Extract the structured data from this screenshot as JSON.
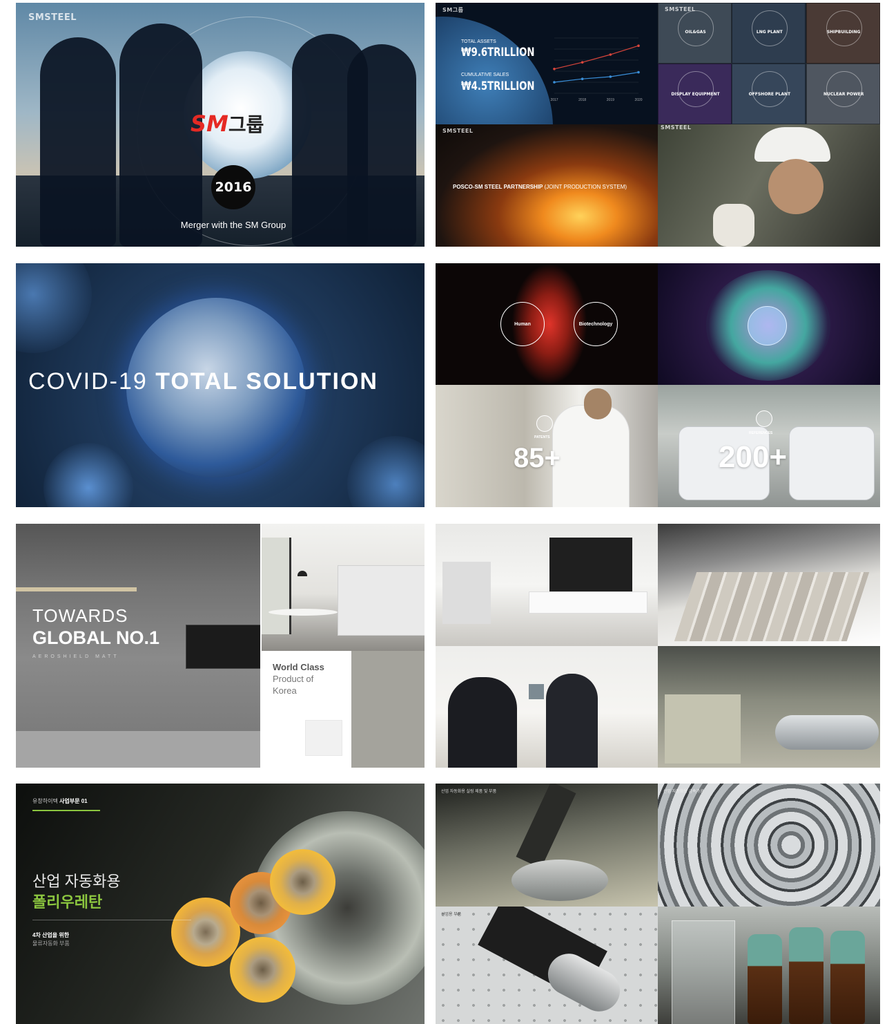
{
  "row1": {
    "sm_group": {
      "brand": "SMSTEEL",
      "logo_sm": "SM",
      "logo_kr": "그룹",
      "year": "2016",
      "caption": "Merger with the SM Group"
    },
    "assets": {
      "brand": "SM그룹",
      "total_assets_label": "TOTAL ASSETS",
      "total_assets_value": "₩9.6TRILLION",
      "cumulative_sales_label": "CUMULATIVE SALES",
      "cumulative_sales_value": "₩4.5TRILLION",
      "chart_data": {
        "type": "line",
        "categories": [
          "2017",
          "2018",
          "2019",
          "2020"
        ],
        "series": [
          {
            "values": [
              2.2,
              2.8,
              3.5,
              4.3
            ]
          },
          {
            "values": [
              1.0,
              1.3,
              1.5,
              1.9
            ]
          }
        ],
        "colors": [
          "#d9453b",
          "#3a8fd9"
        ]
      }
    },
    "industries": {
      "brand": "SMSTEEL",
      "items": [
        "OIL&GAS",
        "LNG PLANT",
        "SHIPBUILDING",
        "DISPLAY EQUIPMENT",
        "OFFSHORE PLANT",
        "NUCLEAR POWER"
      ]
    },
    "posco": {
      "brand": "SMSTEEL",
      "caption_bold": "POSCO-SM STEEL PARTNERSHIP",
      "caption_light": "(JOINT PRODUCTION SYSTEM)"
    },
    "worker": {
      "brand": "SMSTEEL"
    }
  },
  "row2": {
    "covid": {
      "title_light": "COVID-19",
      "title_bold": "TOTAL SOLUTION"
    },
    "bio": {
      "left_circle": "Human",
      "right_circle": "Biotechnology"
    },
    "patents": {
      "label": "PATENTS",
      "value": "85+"
    },
    "references": {
      "label": "REFERENCES",
      "value": "200+"
    }
  },
  "row3": {
    "kitchen": {
      "line1": "TOWARDS",
      "line2": "GLOBAL NO.1",
      "sub": "AEROSHIELD MATT"
    },
    "world_class": {
      "line1": "World Class",
      "line2": "Product of",
      "line3": "Korea"
    }
  },
  "row4": {
    "polyurethane": {
      "tag_light": "유창하이텍",
      "tag_bold": "사업부문 01",
      "title_light": "산업 자동화용",
      "title_bold": "폴리우레탄",
      "sub1": "4차 산업을 위한",
      "sub2": "물류자동화 부품"
    },
    "parts": {
      "tl_label": "산업 자동화용 실링 제품 및 부품",
      "tr_label": "산업 자동화용 금속가공",
      "bl_label": "산업용 부품"
    }
  }
}
